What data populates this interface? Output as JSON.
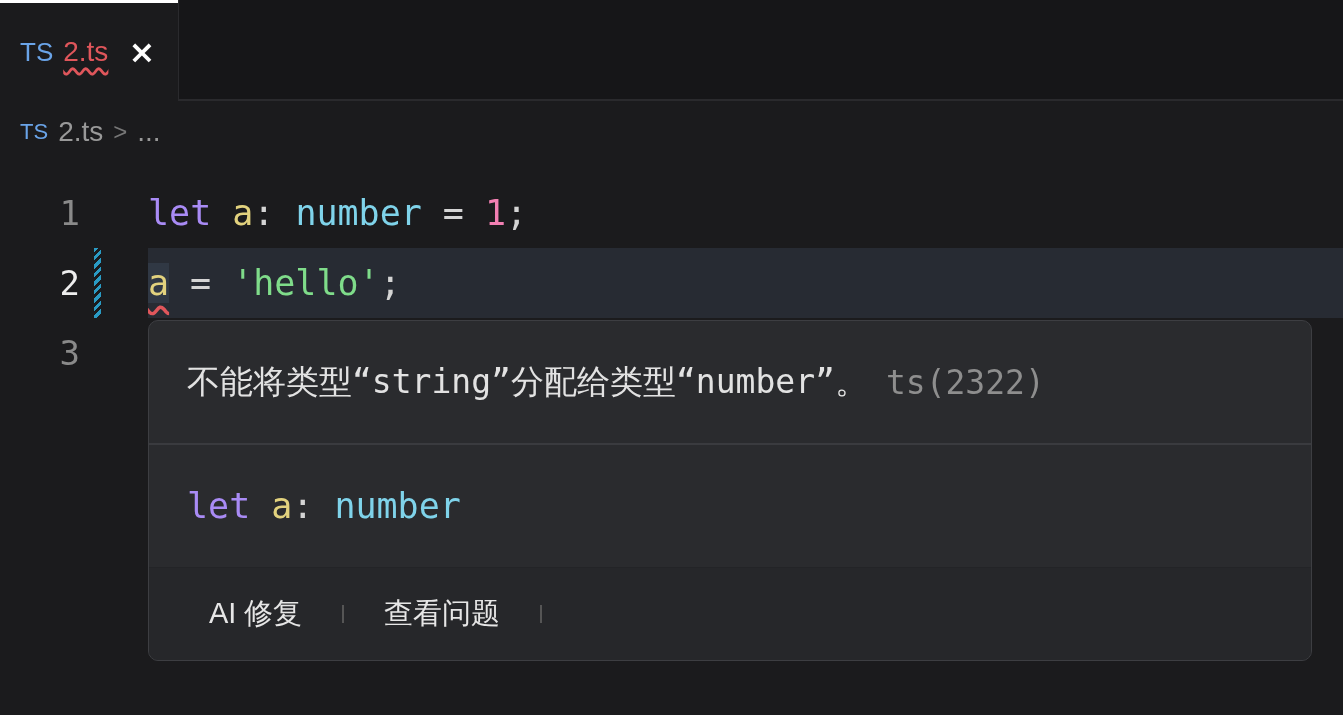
{
  "tabs": [
    {
      "icon_label": "TS",
      "label": "2.ts",
      "selected": true,
      "has_error": true,
      "close": "×"
    }
  ],
  "breadcrumb": {
    "icon_label": "TS",
    "file": "2.ts",
    "separator": ">",
    "rest": "..."
  },
  "lines": [
    {
      "number": "1",
      "current": false,
      "modified": false,
      "tokens": [
        {
          "kind": "keyword",
          "text": "let"
        },
        {
          "kind": "variable",
          "text": "a",
          "space_before": true
        },
        {
          "kind": "punct",
          "text": ":"
        },
        {
          "kind": "type",
          "text": "number",
          "space_before": true
        },
        {
          "kind": "punct",
          "text": "=",
          "space_before": true
        },
        {
          "kind": "number",
          "text": "1",
          "space_before": true
        },
        {
          "kind": "punct",
          "text": ";"
        }
      ]
    },
    {
      "number": "2",
      "current": true,
      "modified": true,
      "tokens": [
        {
          "kind": "variable",
          "text": "a",
          "error": true
        },
        {
          "kind": "punct",
          "text": "=",
          "space_before": true
        },
        {
          "kind": "string",
          "text": "'hello'",
          "space_before": true
        },
        {
          "kind": "punct",
          "text": ";"
        }
      ]
    },
    {
      "number": "3",
      "current": false,
      "modified": false
    }
  ],
  "hover": {
    "message": "不能将类型“string”分配给类型“number”。",
    "code": "ts(2322)",
    "signature": [
      {
        "kind": "keyword",
        "text": "let"
      },
      {
        "kind": "variable",
        "text": "a",
        "space_before": true
      },
      {
        "kind": "punct",
        "text": ":"
      },
      {
        "kind": "type",
        "text": "number",
        "space_before": true
      }
    ],
    "actions": [
      "AI 修复",
      "查看问题"
    ]
  }
}
